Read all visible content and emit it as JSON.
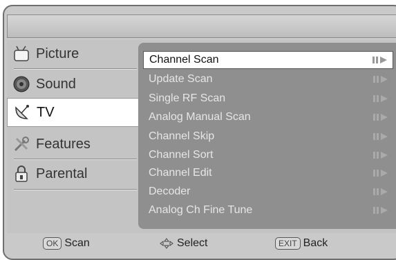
{
  "sidebar": {
    "items": [
      {
        "label": "Picture",
        "icon": "tv-set-icon"
      },
      {
        "label": "Sound",
        "icon": "speaker-icon"
      },
      {
        "label": "TV",
        "icon": "satellite-dish-icon",
        "selected": true
      },
      {
        "label": "Features",
        "icon": "tools-icon"
      },
      {
        "label": "Parental",
        "icon": "padlock-icon"
      }
    ]
  },
  "submenu": {
    "items": [
      {
        "label": "Channel Scan",
        "active": true
      },
      {
        "label": "Update Scan"
      },
      {
        "label": "Single RF Scan"
      },
      {
        "label": "Analog Manual Scan"
      },
      {
        "label": "Channel Skip"
      },
      {
        "label": "Channel Sort"
      },
      {
        "label": "Channel Edit"
      },
      {
        "label": "Decoder"
      },
      {
        "label": "Analog Ch Fine Tune"
      }
    ]
  },
  "footer": {
    "ok_key": "OK",
    "ok_label": "Scan",
    "nav_label": "Select",
    "exit_key": "EXIT",
    "exit_label": "Back"
  }
}
